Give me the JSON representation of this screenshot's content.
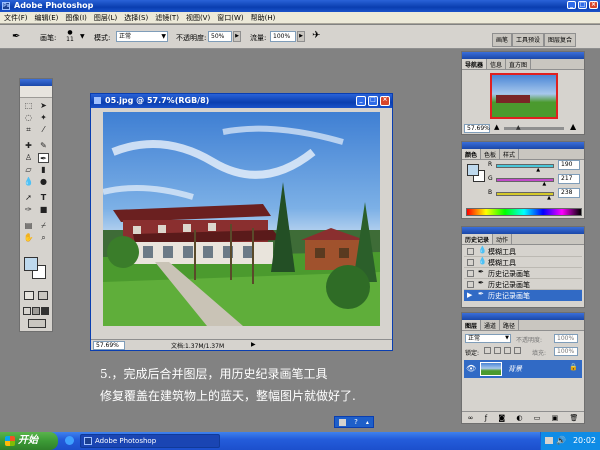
{
  "app": {
    "title": "Adobe Photoshop"
  },
  "menu": [
    "文件(F)",
    "编辑(E)",
    "图像(I)",
    "图层(L)",
    "选择(S)",
    "滤镜(T)",
    "视图(V)",
    "窗口(W)",
    "帮助(H)"
  ],
  "options_bar": {
    "brush_label": "画笔:",
    "brush_size": "11",
    "mode_label": "模式:",
    "mode_value": "正常",
    "opacity_label": "不透明度:",
    "opacity_value": "50%",
    "flow_label": "流量:",
    "flow_value": "100%",
    "palette_tabs": [
      "画笔",
      "工具预设",
      "图层复合"
    ]
  },
  "document": {
    "title": "05.jpg @ 57.7%(RGB/8)",
    "zoom": "57.69%",
    "status": "文档:1.37M/1.37M"
  },
  "navigator": {
    "tabs": [
      "导航器",
      "信息",
      "直方图"
    ],
    "zoom": "57.69%"
  },
  "color": {
    "tabs": [
      "颜色",
      "色板",
      "样式"
    ],
    "channels": [
      {
        "label": "R",
        "value": "190",
        "fraction": 0.745,
        "color": "#4ac7d9"
      },
      {
        "label": "G",
        "value": "217",
        "fraction": 0.851,
        "color": "#c24ac9"
      },
      {
        "label": "B",
        "value": "238",
        "fraction": 0.933,
        "color": "#d4c92a"
      }
    ],
    "foreground": "#beD9EE"
  },
  "history": {
    "tabs": [
      "历史记录",
      "动作"
    ],
    "items": [
      {
        "label": "模糊工具",
        "active": false
      },
      {
        "label": "模糊工具",
        "active": false
      },
      {
        "label": "历史记录画笔",
        "active": false
      },
      {
        "label": "历史记录画笔",
        "active": false
      },
      {
        "label": "历史记录画笔",
        "active": true
      }
    ]
  },
  "layers": {
    "tabs": [
      "图层",
      "通道",
      "路径"
    ],
    "blend_mode": "正常",
    "opacity_label": "不透明度:",
    "opacity_value": "100%",
    "lock_label": "锁定:",
    "fill_label": "填充:",
    "fill_value": "100%",
    "layer_name": "背景"
  },
  "caption": {
    "line1": "5.，完成后合并图层，用历史纪录画笔工具",
    "line2": "修复覆盖在建筑物上的蓝天，整幅图片就做好了."
  },
  "taskbar": {
    "start": "开始",
    "task": "Adobe Photoshop",
    "time": "20:02"
  },
  "colors": {
    "xp_blue": "#0a3eb0",
    "selection": "#316ac5",
    "start_green": "#3c9a36"
  }
}
